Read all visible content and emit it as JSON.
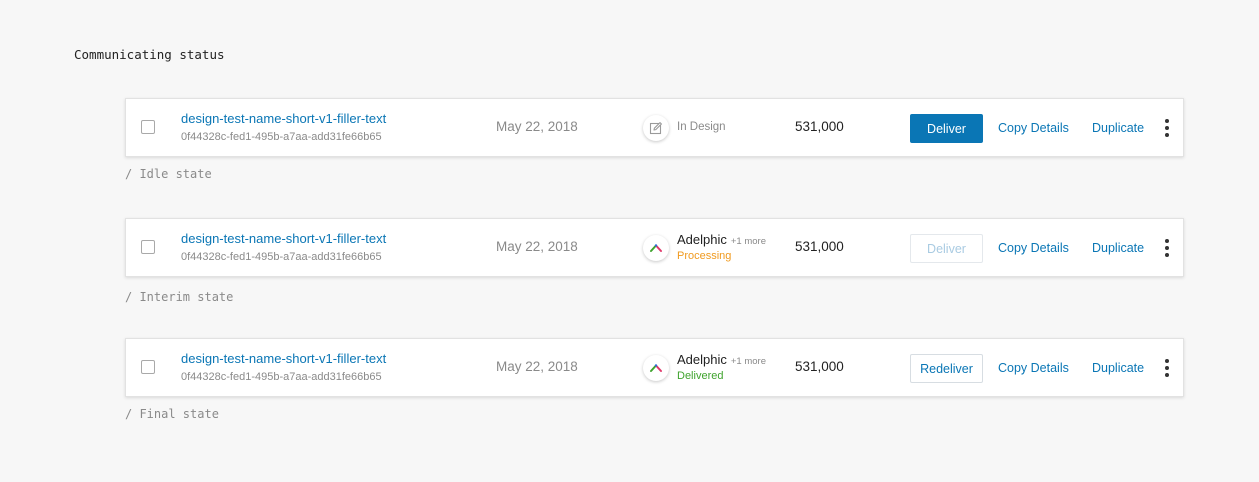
{
  "title": "Communicating status",
  "colors": {
    "accent": "#0a76b5",
    "processing": "#f09a1f",
    "delivered": "#3fa32d"
  },
  "rows": [
    {
      "name": "design-test-name-short-v1-filler-text",
      "id": "0f44328c-fed1-495b-a7aa-add31fe66b65",
      "date": "May 22, 2018",
      "status_icon": "edit-icon",
      "status": "In Design",
      "count": "531,000",
      "primary_button": "Deliver",
      "primary_button_state": "enabled",
      "copy_label": "Copy Details",
      "duplicate_label": "Duplicate",
      "state_label": "/ Idle state"
    },
    {
      "name": "design-test-name-short-v1-filler-text",
      "id": "0f44328c-fed1-495b-a7aa-add31fe66b65",
      "date": "May 22, 2018",
      "status_icon": "adelphic-logo-icon",
      "partner": "Adelphic",
      "more": "+1 more",
      "status": "Processing",
      "count": "531,000",
      "primary_button": "Deliver",
      "primary_button_state": "disabled",
      "copy_label": "Copy Details",
      "duplicate_label": "Duplicate",
      "state_label": "/ Interim state"
    },
    {
      "name": "design-test-name-short-v1-filler-text",
      "id": "0f44328c-fed1-495b-a7aa-add31fe66b65",
      "date": "May 22, 2018",
      "status_icon": "adelphic-logo-icon",
      "partner": "Adelphic",
      "more": "+1 more",
      "status": "Delivered",
      "count": "531,000",
      "primary_button": "Redeliver",
      "primary_button_state": "outline",
      "copy_label": "Copy Details",
      "duplicate_label": "Duplicate",
      "state_label": "/ Final state"
    }
  ]
}
